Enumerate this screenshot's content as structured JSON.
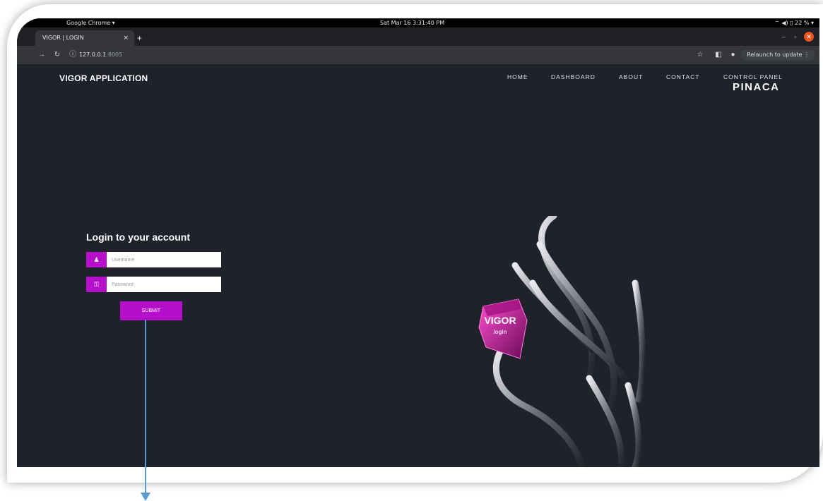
{
  "os": {
    "app_menu": "Google Chrome ▾",
    "clock": "Sat Mar 16  3:31:40 PM",
    "tray": "⌔  ◀)  ▯ 22 % ▾"
  },
  "browser": {
    "tab_title": "VIGOR | LOGIN",
    "tab_close": "×",
    "new_tab": "+",
    "url_host": "127.0.0.1",
    "url_port": ":8005",
    "relaunch_label": "Relaunch to update ⋮",
    "win_min": "–",
    "win_max": "▫",
    "win_close": "✕"
  },
  "nav": {
    "brand": "VIGOR APPLICATION",
    "links": [
      "HOME",
      "DASHBOARD",
      "ABOUT",
      "CONTACT",
      "CONTROL PANEL"
    ],
    "sub_brand": "PINACA"
  },
  "login": {
    "title": "Login to your account",
    "username_placeholder": "Username",
    "password_placeholder": "Password",
    "submit_label": "SUBMIT"
  },
  "hero": {
    "cube_text": "VIGOR",
    "cube_subtext": "login"
  },
  "colors": {
    "accent": "#b60fcc",
    "background": "#1f222b",
    "annotation_arrow": "#5b9bd5"
  }
}
